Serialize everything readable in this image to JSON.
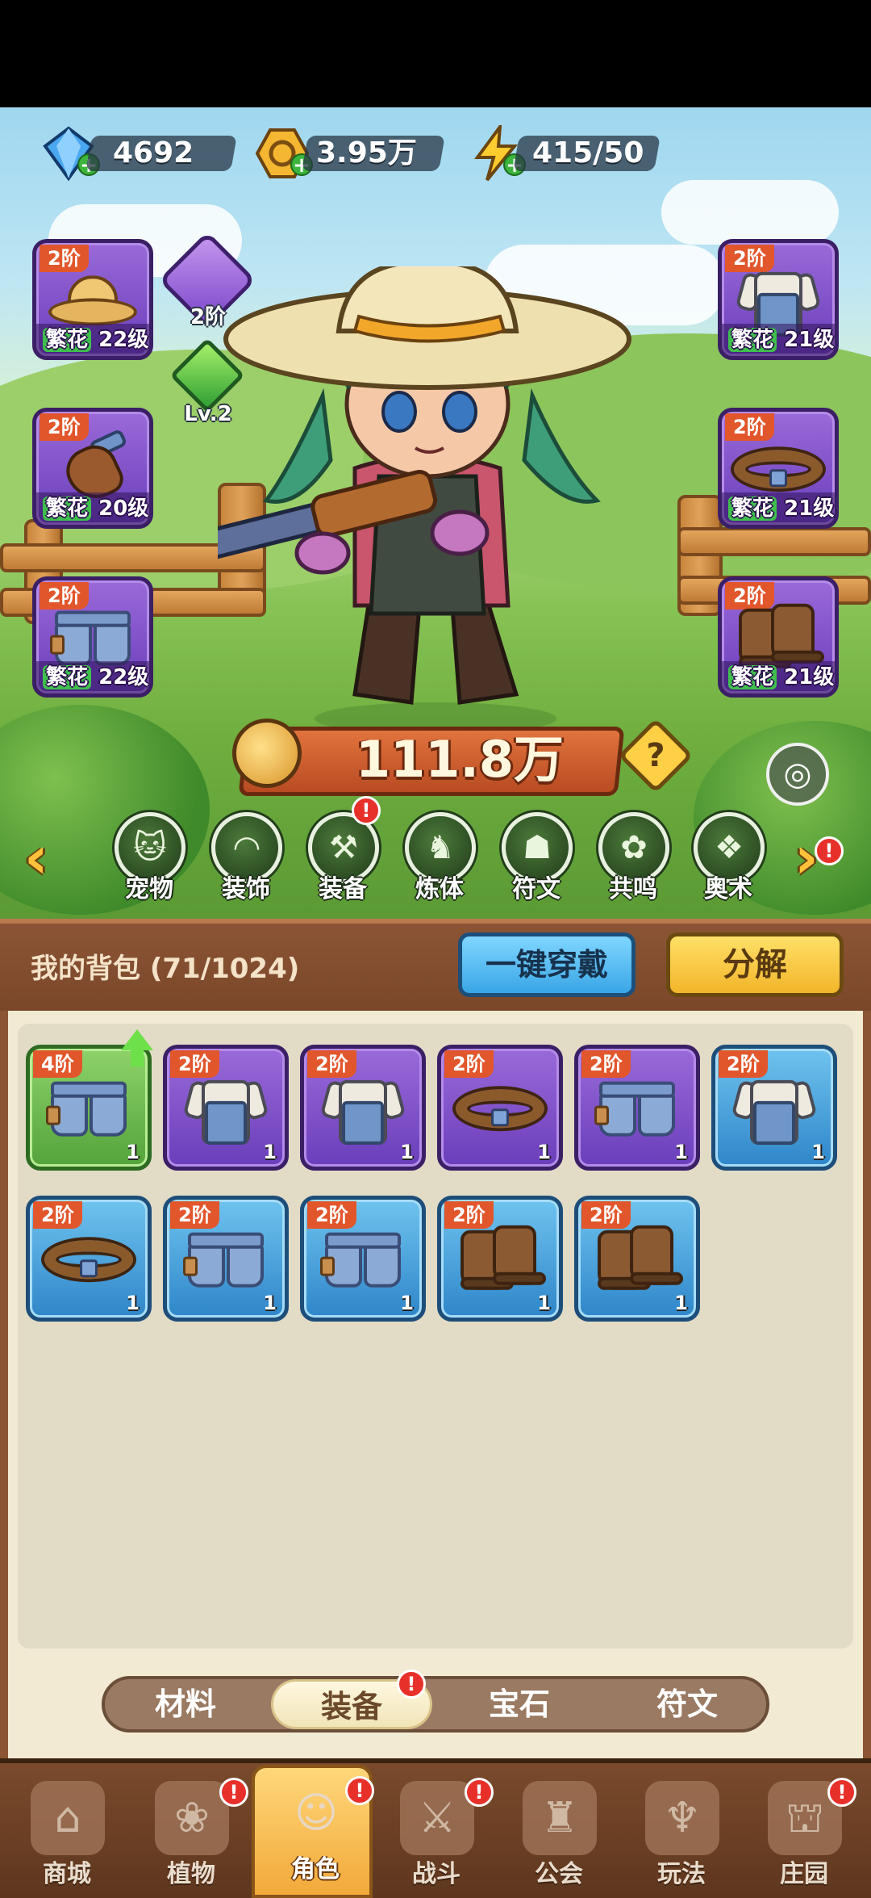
{
  "currencies": [
    {
      "name": "diamond",
      "icon": "diamond-icon",
      "value": "4692"
    },
    {
      "name": "gold",
      "icon": "gold-coin-icon",
      "value": "3.95万"
    },
    {
      "name": "energy",
      "icon": "lightning-icon",
      "value": "415/50"
    }
  ],
  "equipment": {
    "left": [
      {
        "tier": "2阶",
        "set": "繁花",
        "level": "22级",
        "icon": "straw-hat-icon"
      },
      {
        "tier": "2阶",
        "set": "繁花",
        "level": "20级",
        "icon": "glove-icon"
      },
      {
        "tier": "2阶",
        "set": "繁花",
        "level": "22级",
        "icon": "shorts-icon"
      }
    ],
    "right": [
      {
        "tier": "2阶",
        "set": "繁花",
        "level": "21级",
        "icon": "shirt-icon"
      },
      {
        "tier": "2阶",
        "set": "繁花",
        "level": "21级",
        "icon": "belt-icon"
      },
      {
        "tier": "2阶",
        "set": "繁花",
        "level": "21级",
        "icon": "boots-icon"
      }
    ]
  },
  "rank": {
    "label": "2阶",
    "icon": "rank-emblem-icon"
  },
  "gem": {
    "label": "Lv.2",
    "icon": "green-gem-icon"
  },
  "power": {
    "value": "111.8万"
  },
  "help_label": "?",
  "functions": [
    {
      "label": "宠物",
      "icon": "cat-icon",
      "alert": false
    },
    {
      "label": "装饰",
      "icon": "mask-icon",
      "alert": false
    },
    {
      "label": "装备",
      "icon": "hammer-icon",
      "alert": true
    },
    {
      "label": "炼体",
      "icon": "figure-icon",
      "alert": false
    },
    {
      "label": "符文",
      "icon": "rune-icon",
      "alert": false
    },
    {
      "label": "共鸣",
      "icon": "tree-icon",
      "alert": false
    },
    {
      "label": "奥术",
      "icon": "book-icon",
      "alert": false
    }
  ],
  "alert_mark": "!",
  "backpack": {
    "title": "我的背包 (71/1024)",
    "wear_all_label": "一键穿戴",
    "decompose_label": "分解",
    "items": [
      {
        "tier": "4阶",
        "count": "1",
        "rarity": "green",
        "kind": "shorts",
        "upgrade": true
      },
      {
        "tier": "2阶",
        "count": "1",
        "rarity": "purple",
        "kind": "shirt"
      },
      {
        "tier": "2阶",
        "count": "1",
        "rarity": "purple",
        "kind": "shirt"
      },
      {
        "tier": "2阶",
        "count": "1",
        "rarity": "purple",
        "kind": "belt"
      },
      {
        "tier": "2阶",
        "count": "1",
        "rarity": "purple",
        "kind": "shorts"
      },
      {
        "tier": "2阶",
        "count": "1",
        "rarity": "blue",
        "kind": "shirt"
      },
      {
        "tier": "2阶",
        "count": "1",
        "rarity": "blue",
        "kind": "belt"
      },
      {
        "tier": "2阶",
        "count": "1",
        "rarity": "blue",
        "kind": "shorts"
      },
      {
        "tier": "2阶",
        "count": "1",
        "rarity": "blue",
        "kind": "shorts"
      },
      {
        "tier": "2阶",
        "count": "1",
        "rarity": "blue",
        "kind": "boots"
      },
      {
        "tier": "2阶",
        "count": "1",
        "rarity": "blue",
        "kind": "boots"
      }
    ]
  },
  "category_tabs": [
    {
      "label": "材料",
      "active": false,
      "alert": false
    },
    {
      "label": "装备",
      "active": true,
      "alert": true
    },
    {
      "label": "宝石",
      "active": false,
      "alert": false
    },
    {
      "label": "符文",
      "active": false,
      "alert": false
    }
  ],
  "bottom_nav": [
    {
      "label": "商城",
      "icon": "shop-icon",
      "active": false,
      "alert": false
    },
    {
      "label": "植物",
      "icon": "plant-icon",
      "active": false,
      "alert": true
    },
    {
      "label": "角色",
      "icon": "character-icon",
      "active": true,
      "alert": true
    },
    {
      "label": "战斗",
      "icon": "battle-icon",
      "active": false,
      "alert": true
    },
    {
      "label": "公会",
      "icon": "guild-icon",
      "active": false,
      "alert": false
    },
    {
      "label": "玩法",
      "icon": "gameplay-icon",
      "active": false,
      "alert": false
    },
    {
      "label": "庄园",
      "icon": "manor-icon",
      "active": false,
      "alert": true
    }
  ]
}
